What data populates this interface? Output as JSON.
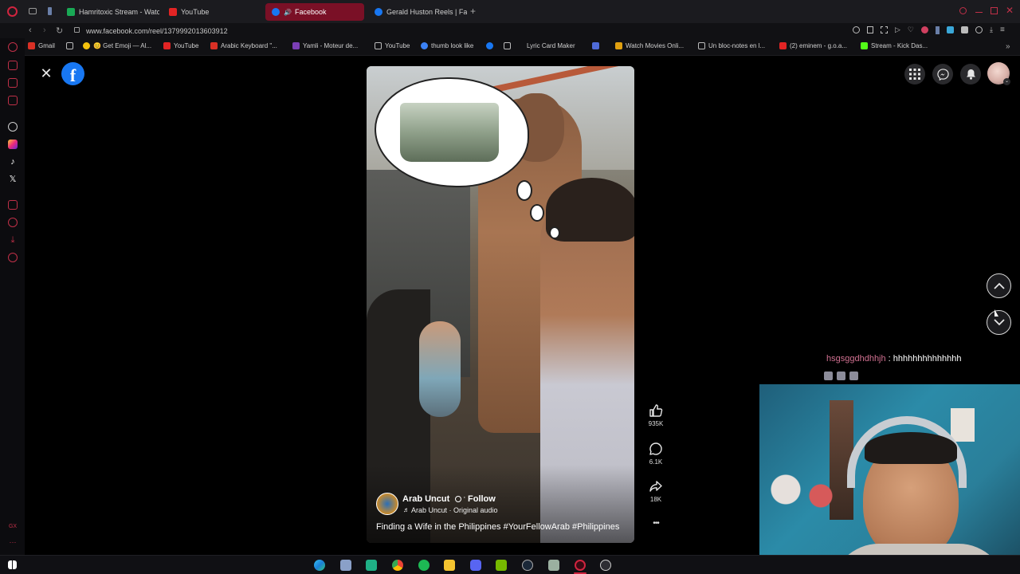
{
  "browser": {
    "tabs": [
      {
        "label": "Hamritoxic Stream - Watch",
        "color": "#19a955"
      },
      {
        "label": "YouTube",
        "color": "#e22424"
      },
      {
        "label": "Facebook",
        "color": "#1877f2",
        "active": true
      },
      {
        "label": "Gerald Huston Reels | Face",
        "color": "#1877f2"
      }
    ],
    "new_tab_symbol": "+",
    "url": "www.facebook.com/reel/1379992013603912",
    "bookmarks": [
      {
        "label": "Gmail",
        "color": "#d93025"
      },
      {
        "label": "",
        "color": "#bbbbbb"
      },
      {
        "label": "😊 Get Emoji — Al...",
        "color": "#f4c20d"
      },
      {
        "label": "YouTube",
        "color": "#e22424"
      },
      {
        "label": "Arabic Keyboard \"...",
        "color": "#d93025"
      },
      {
        "label": "Yamli - Moteur de...",
        "color": "#7b3fb5"
      },
      {
        "label": "YouTube",
        "color": "#bbbbbb"
      },
      {
        "label": "thumb look like",
        "color": "#3b82f6"
      },
      {
        "label": "",
        "color": "#1877f2"
      },
      {
        "label": "Lyric Card Maker",
        "color": "#bbbbbb"
      },
      {
        "label": "",
        "color": "#4f6bd8"
      },
      {
        "label": "Watch Movies Onli...",
        "color": "#e0a010"
      },
      {
        "label": "Un bloc-notes en l...",
        "color": "#bbbbbb"
      },
      {
        "label": "(2) eminem - g.o.a...",
        "color": "#e22424"
      },
      {
        "label": "Stream - Kick Das...",
        "color": "#53fc18"
      }
    ]
  },
  "reel": {
    "author": "Arab Uncut",
    "follow_label": "Follow",
    "audio": "Arab Uncut · Original audio",
    "caption": "Finding a Wife in the Philippines #YourFellowArab #Philippines",
    "likes": "935K",
    "comments": "6.1K",
    "shares": "18K",
    "more_label": "•••"
  },
  "chat": {
    "username": "hsgsggdhdhhjh",
    "separator": " : ",
    "message": "hhhhhhhhhhhhhh",
    "username_color": "#d07090"
  },
  "colors": {
    "accent": "#1877f2",
    "active_tab": "#7a1026"
  }
}
